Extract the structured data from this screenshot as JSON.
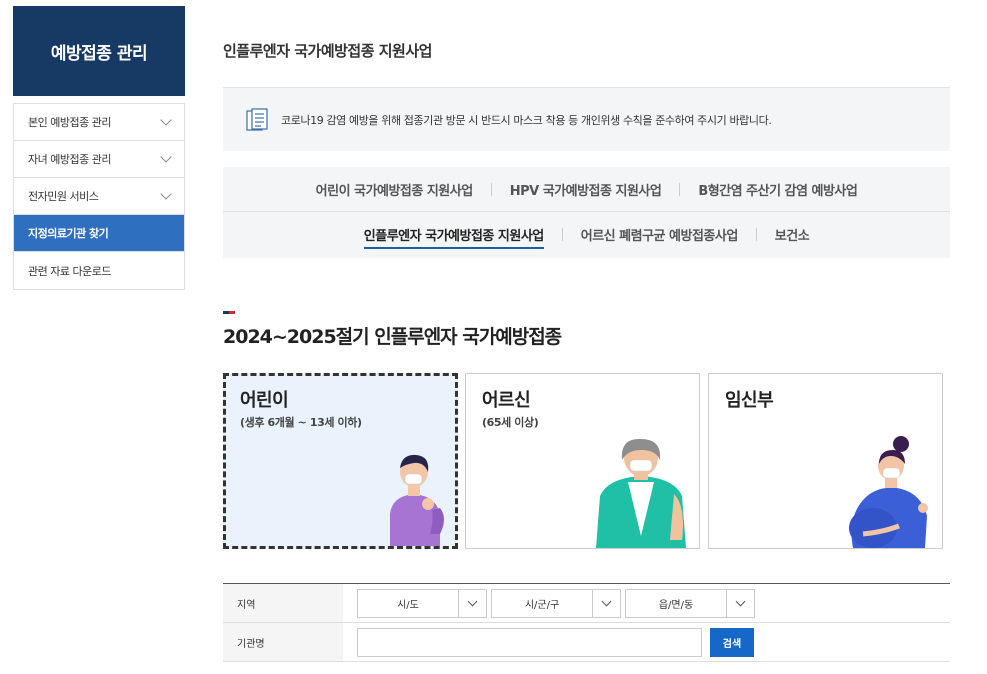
{
  "sidebar": {
    "title": "예방접종 관리",
    "items": [
      {
        "label": "본인 예방접종 관리"
      },
      {
        "label": "자녀 예방접종 관리"
      },
      {
        "label": "전자민원 서비스"
      },
      {
        "label": "지정의료기관 찾기"
      },
      {
        "label": "관련 자료 다운로드"
      }
    ]
  },
  "main": {
    "title": "인플루엔자 국가예방접종 지원사업",
    "notice": "코로나19 감염 예방을 위해 접종기관 방문 시 반드시 마스크 착용 등 개인위생 수칙을 준수하여 주시기 바랍니다.",
    "tabs_row1": [
      "어린이 국가예방접종 지원사업",
      "HPV 국가예방접종 지원사업",
      "B형간염 주산기 감염 예방사업"
    ],
    "tabs_row2": [
      "인플루엔자 국가예방접종 지원사업",
      "어르신 폐렴구균 예방접종사업",
      "보건소"
    ],
    "section_title": "2024~2025절기 인플루엔자 국가예방접종",
    "cards": [
      {
        "title": "어린이",
        "sub": "(생후 6개월 ~ 13세 이하)"
      },
      {
        "title": "어르신",
        "sub": "(65세 이상)"
      },
      {
        "title": "임신부",
        "sub": ""
      }
    ]
  },
  "search": {
    "region_label": "지역",
    "sido": "시/도",
    "sigungu": "시/군/구",
    "eupmyeondong": "읍/면/동",
    "org_label": "기관명",
    "org_value": "",
    "button": "검색"
  },
  "colors": {
    "sidebar_header": "#163a64",
    "active": "#2f6fc0",
    "search_button": "#1668c8"
  }
}
